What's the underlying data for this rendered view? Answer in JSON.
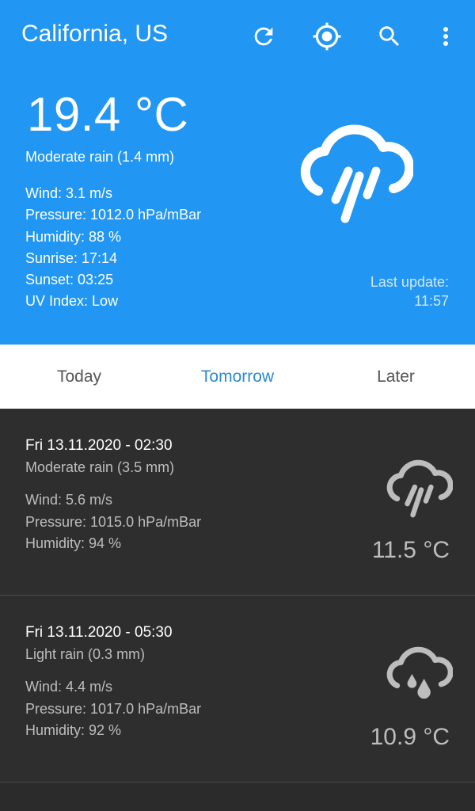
{
  "toolbar": {
    "title": "California, US",
    "actions": [
      {
        "name": "refresh-icon"
      },
      {
        "name": "location-icon"
      },
      {
        "name": "search-icon"
      },
      {
        "name": "more-vert-icon"
      }
    ]
  },
  "current": {
    "temperature": "19.4 °C",
    "description": "Moderate rain (1.4 mm)",
    "wind": "Wind: 3.1 m/s",
    "pressure": "Pressure: 1012.0 hPa/mBar",
    "humidity": "Humidity: 88 %",
    "sunrise": "Sunrise: 17:14",
    "sunset": "Sunset: 03:25",
    "uv": "UV Index: Low",
    "icon": "rain-cloud-icon",
    "last_update_label": "Last update:",
    "last_update_time": "11:57"
  },
  "tabs": [
    {
      "label": "Today",
      "active": false
    },
    {
      "label": "Tomorrow",
      "active": true
    },
    {
      "label": "Later",
      "active": false
    }
  ],
  "forecast": [
    {
      "datetime": "Fri 13.11.2020 - 02:30",
      "description": "Moderate rain (3.5 mm)",
      "wind": "Wind: 5.6 m/s",
      "pressure": "Pressure: 1015.0 hPa/mBar",
      "humidity": "Humidity: 94 %",
      "temperature": "11.5 °C",
      "icon": "rain-cloud-icon"
    },
    {
      "datetime": "Fri 13.11.2020 - 05:30",
      "description": "Light rain (0.3 mm)",
      "wind": "Wind: 4.4 m/s",
      "pressure": "Pressure: 1017.0 hPa/mBar",
      "humidity": "Humidity: 92 %",
      "temperature": "10.9 °C",
      "icon": "drizzle-cloud-icon"
    }
  ],
  "colors": {
    "primary": "#2196f3",
    "tab_active": "#2a8ad4",
    "list_background": "#2e2e2e"
  }
}
